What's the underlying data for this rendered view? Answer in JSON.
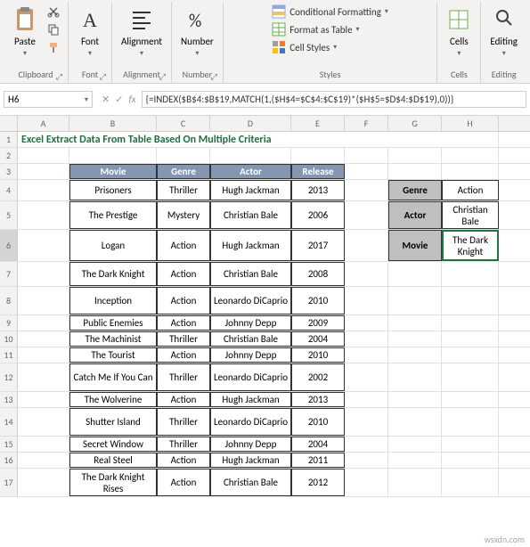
{
  "ribbon": {
    "clipboard": {
      "label": "Clipboard",
      "paste": "Paste"
    },
    "font": {
      "label": "Font",
      "btn": "Font"
    },
    "alignment": {
      "label": "Alignment",
      "btn": "Alignment"
    },
    "number": {
      "label": "Number",
      "btn": "Number"
    },
    "styles": {
      "label": "Styles",
      "cond": "Conditional Formatting",
      "table": "Format as Table",
      "cell": "Cell Styles"
    },
    "cells": {
      "label": "Cells",
      "btn": "Cells"
    },
    "editing": {
      "label": "Editing",
      "btn": "Editing"
    }
  },
  "namebox": "H6",
  "formula": "{=INDEX($B$4:$B$19,MATCH(1,($H$4=$C$4:$C$19)*($H$5=$D$4:$D$19),0))}",
  "cols": [
    "A",
    "B",
    "C",
    "D",
    "E",
    "F",
    "G",
    "H"
  ],
  "title": "Excel Extract Data From Table Based On Multiple Criteria",
  "table": {
    "headers": [
      "Movie",
      "Genre",
      "Actor",
      "Release"
    ],
    "rows": [
      [
        "Prisoners",
        "Thriller",
        "Hugh Jackman",
        "2013"
      ],
      [
        "The Prestige",
        "Mystery",
        "Christian Bale",
        "2006"
      ],
      [
        "Logan",
        "Action",
        "Hugh Jackman",
        "2017"
      ],
      [
        "The Dark Knight",
        "Action",
        "Christian Bale",
        "2008"
      ],
      [
        "Inception",
        "Action",
        "Leonardo DiCaprio",
        "2010"
      ],
      [
        "Public Enemies",
        "Action",
        "Johnny Depp",
        "2009"
      ],
      [
        "The Machinist",
        "Thriller",
        "Christian Bale",
        "2004"
      ],
      [
        "The Tourist",
        "Action",
        "Johnny Depp",
        "2010"
      ],
      [
        "Catch Me If You Can",
        "Thriller",
        "Leonardo DiCaprio",
        "2002"
      ],
      [
        "The Wolverine",
        "Action",
        "Hugh Jackman",
        "2013"
      ],
      [
        "Shutter Island",
        "Thriller",
        "Leonardo DiCaprio",
        "2010"
      ],
      [
        "Secret Window",
        "Thriller",
        "Johnny Depp",
        "2004"
      ],
      [
        "Real Steel",
        "Action",
        "Hugh Jackman",
        "2011"
      ],
      [
        "The Dark Knight Rises",
        "Action",
        "Christian Bale",
        "2012"
      ]
    ]
  },
  "lookup": {
    "genre_l": "Genre",
    "genre_v": "Action",
    "actor_l": "Actor",
    "actor_v": "Christian Bale",
    "movie_l": "Movie",
    "movie_v": "The Dark Knight"
  },
  "watermark": "wsxdn.com"
}
